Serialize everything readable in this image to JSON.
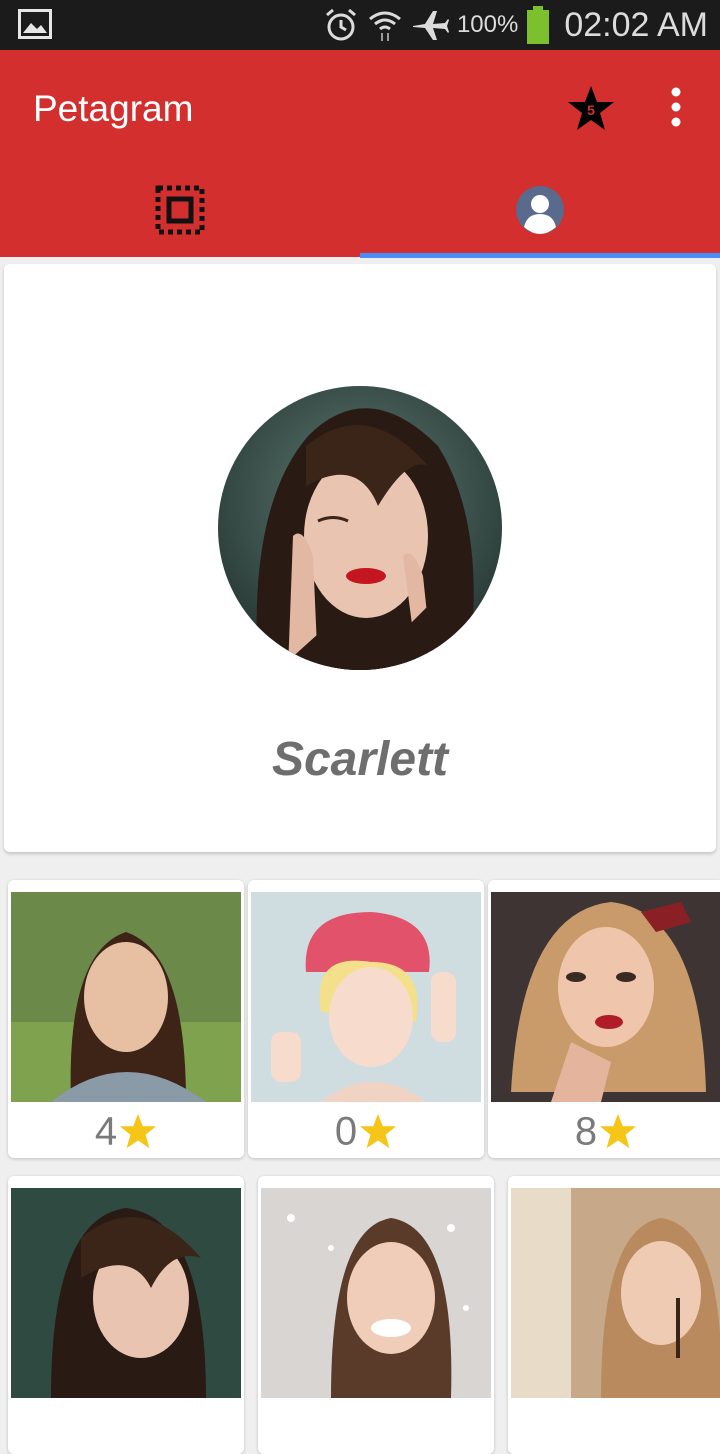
{
  "status_bar": {
    "battery_percent": "100%",
    "time": "02:02 AM",
    "icons": [
      "gallery-icon",
      "alarm-icon",
      "wifi-icon",
      "airplane-icon",
      "battery-icon"
    ]
  },
  "app_bar": {
    "title": "Petagram",
    "favorites_count": "5",
    "colors": {
      "primary": "#d32f2f",
      "tab_indicator": "#4a8df8",
      "star": "#f5c518"
    }
  },
  "tabs": [
    {
      "icon": "feed-grid-icon",
      "selected": false
    },
    {
      "icon": "profile-person-icon",
      "selected": true
    }
  ],
  "profile": {
    "name": "Scarlett",
    "avatar": "profile-photo"
  },
  "photos": [
    {
      "likes": "4"
    },
    {
      "likes": "0"
    },
    {
      "likes": "8"
    },
    {
      "likes": ""
    },
    {
      "likes": ""
    },
    {
      "likes": ""
    }
  ]
}
